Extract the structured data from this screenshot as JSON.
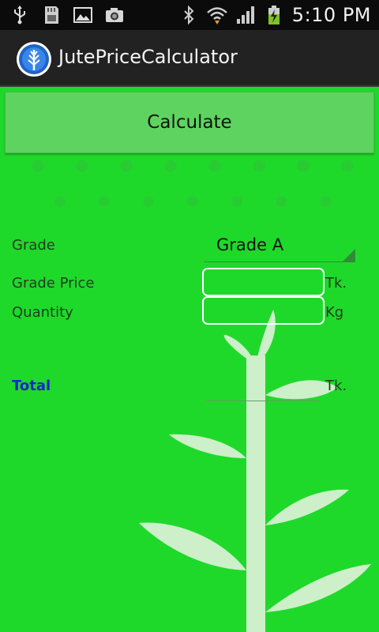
{
  "status_bar": {
    "time": "5:10 PM",
    "left_icons": [
      "usb-icon",
      "sd-card-icon",
      "image-icon",
      "camera-icon"
    ],
    "right_icons": [
      "bluetooth-icon",
      "wifi-icon",
      "signal-icon",
      "battery-charging-icon"
    ]
  },
  "app": {
    "title": "JutePriceCalculator",
    "logo_icon": "jute-plant-logo-icon"
  },
  "main": {
    "calculate_label": "Calculate",
    "grade_label": "Grade",
    "grade_selected": "Grade A",
    "grade_price_label": "Grade Price",
    "grade_price_value": "",
    "grade_price_unit": "Tk.",
    "quantity_label": "Quantity",
    "quantity_value": "",
    "quantity_unit": "Kg",
    "total_label": "Total",
    "total_value": "",
    "total_unit": "Tk."
  },
  "colors": {
    "background": "#1fd92a",
    "button": "#5ed35f",
    "total_label": "#1227c8",
    "plant": "#cdefc9"
  }
}
